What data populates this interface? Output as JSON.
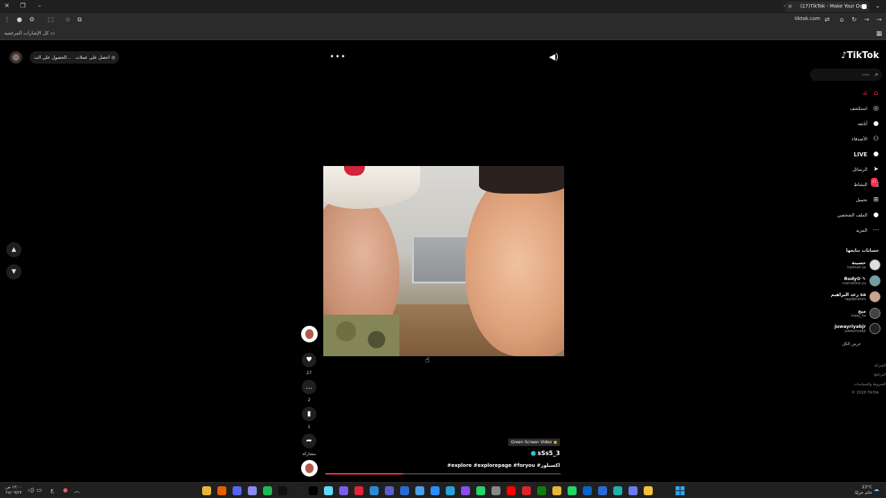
{
  "browser": {
    "tab_title": "(17)TikTok - Make Your Day",
    "url": "tiktok.com",
    "bookmarks_label": "كل الإشارات المرجعية"
  },
  "topbar": {
    "get_coins": "احصل على عملات",
    "get_app": "الحصول على الت...",
    "more_icon": "more-dots-icon",
    "volume_icon": "volume-icon"
  },
  "video": {
    "green_screen_label": "Green Screen Video",
    "author": "sSs5_3",
    "tags": "#explore #explorepage #foryou #اكسبلور",
    "progress_fraction": 0.33
  },
  "actions": {
    "likes": "27",
    "comments": "2",
    "saves": "1",
    "share_label": "مشاركة"
  },
  "sidebar": {
    "logo": "TikTok",
    "search_placeholder": "بحث",
    "nav": [
      {
        "label": "لك",
        "icon": "home-icon",
        "active": true
      },
      {
        "label": "استكشف",
        "icon": "compass-icon"
      },
      {
        "label": "أتابعه",
        "icon": "following-avatar-icon"
      },
      {
        "label": "الأصدقاء",
        "icon": "friends-icon"
      },
      {
        "label": "LIVE",
        "icon": "live-icon"
      },
      {
        "label": "الرسائل",
        "icon": "messages-icon"
      },
      {
        "label": "النشاط",
        "icon": "activity-icon",
        "badge": "17"
      },
      {
        "label": "تحميل",
        "icon": "upload-icon"
      },
      {
        "label": "الملف الشخصي",
        "icon": "profile-icon"
      },
      {
        "label": "المزيد",
        "icon": "more-icon"
      }
    ],
    "following_title": "حسابات تتابعها",
    "following": [
      {
        "name": "حسينة",
        "handle": "haslnah.sa"
      },
      {
        "name": "Rudy✿ ✎",
        "handle": "marcelline.yu"
      },
      {
        "name": "رغد البراهيم sa",
        "handle": "ragdibrahim"
      },
      {
        "name": "ميج",
        "handle": "meej_5a"
      },
      {
        "name": "juwayriyabjr",
        "handle": "juwayriyabjr"
      }
    ],
    "see_all": "عرض الكل",
    "footer": [
      "الشركة",
      "البرنامج",
      "الشروط والسياسات",
      "© 2026 TikTok"
    ]
  },
  "taskbar": {
    "time": "١٣:٠٠ ص",
    "date": "٢٧/٠٩/٢٣",
    "lang": "ع",
    "weather_temp": "23°C",
    "weather_desc": "غائم جزئيًا"
  }
}
